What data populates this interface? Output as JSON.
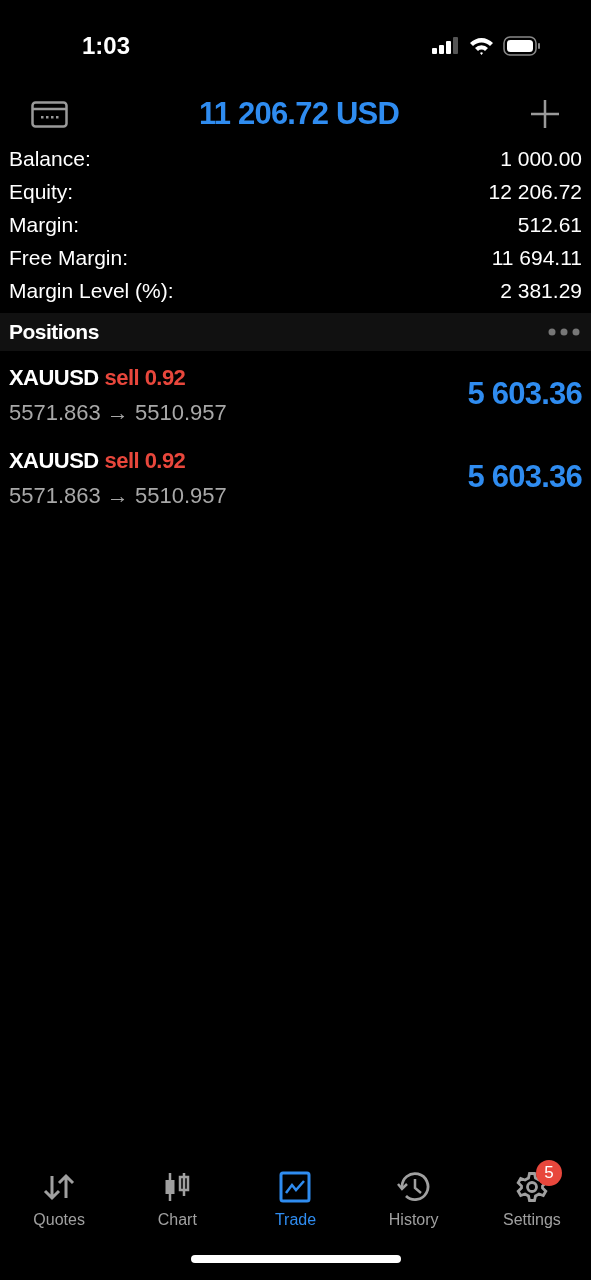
{
  "status_bar": {
    "time": "1:03"
  },
  "header": {
    "title": "11 206.72 USD"
  },
  "account": [
    {
      "label": "Balance:",
      "value": "1 000.00"
    },
    {
      "label": "Equity:",
      "value": "12 206.72"
    },
    {
      "label": "Margin:",
      "value": "512.61"
    },
    {
      "label": "Free Margin:",
      "value": "11 694.11"
    },
    {
      "label": "Margin Level (%):",
      "value": "2 381.29"
    }
  ],
  "positions": {
    "title": "Positions",
    "items": [
      {
        "symbol": "XAUUSD",
        "trade": "sell 0.92",
        "prices": "5571.863 → 5510.957",
        "profit": "5 603.36"
      },
      {
        "symbol": "XAUUSD",
        "trade": "sell 0.92",
        "prices": "5571.863 → 5510.957",
        "profit": "5 603.36"
      }
    ]
  },
  "tabs": [
    {
      "kind": "quotes",
      "label": "Quotes",
      "selected": false
    },
    {
      "kind": "chart",
      "label": "Chart",
      "selected": false
    },
    {
      "kind": "trade",
      "label": "Trade",
      "selected": true
    },
    {
      "kind": "history",
      "label": "History",
      "selected": false
    },
    {
      "kind": "settings",
      "label": "Settings",
      "selected": false,
      "badge": "5"
    }
  ]
}
